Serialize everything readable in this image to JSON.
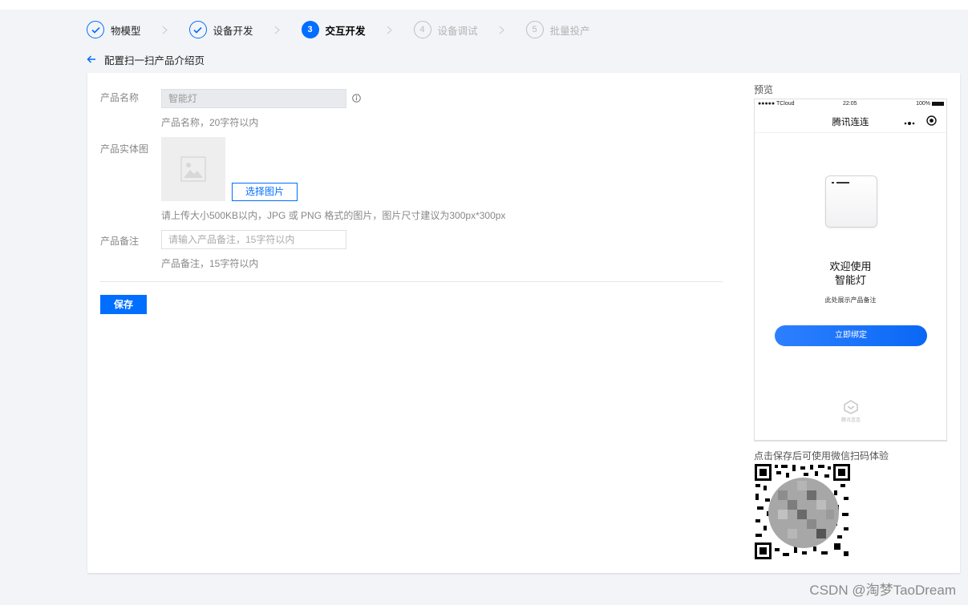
{
  "steps": [
    {
      "index": "1",
      "label": "物模型",
      "state": "done"
    },
    {
      "index": "2",
      "label": "设备开发",
      "state": "done"
    },
    {
      "index": "3",
      "label": "交互开发",
      "state": "active"
    },
    {
      "index": "4",
      "label": "设备调试",
      "state": "pending"
    },
    {
      "index": "5",
      "label": "批量投产",
      "state": "pending"
    }
  ],
  "page": {
    "title": "配置扫一扫产品介绍页"
  },
  "form": {
    "name_label": "产品名称",
    "name_value": "智能灯",
    "name_hint": "产品名称，20字符以内",
    "image_label": "产品实体图",
    "select_image_button": "选择图片",
    "image_hint": "请上传大小500KB以内，JPG 或 PNG 格式的图片，图片尺寸建议为300px*300px",
    "remark_label": "产品备注",
    "remark_placeholder": "请输入产品备注，15字符以内",
    "remark_hint": "产品备注，15字符以内",
    "save_button": "保存"
  },
  "preview": {
    "title": "预览",
    "status_signal": "●●●●● TCloud",
    "status_time": "22:05",
    "status_battery": "100%",
    "app_name": "腾讯连连",
    "welcome_line1": "欢迎使用",
    "welcome_line2": "智能灯",
    "remark_display": "此处展示产品备注",
    "bind_button": "立即绑定",
    "brand_text": "腾讯连连",
    "scan_hint": "点击保存后可使用微信扫码体验"
  },
  "watermark": "CSDN @淘梦TaoDream",
  "colors": {
    "accent": "#006eff",
    "background": "#f3f4f7",
    "card": "#ffffff"
  }
}
